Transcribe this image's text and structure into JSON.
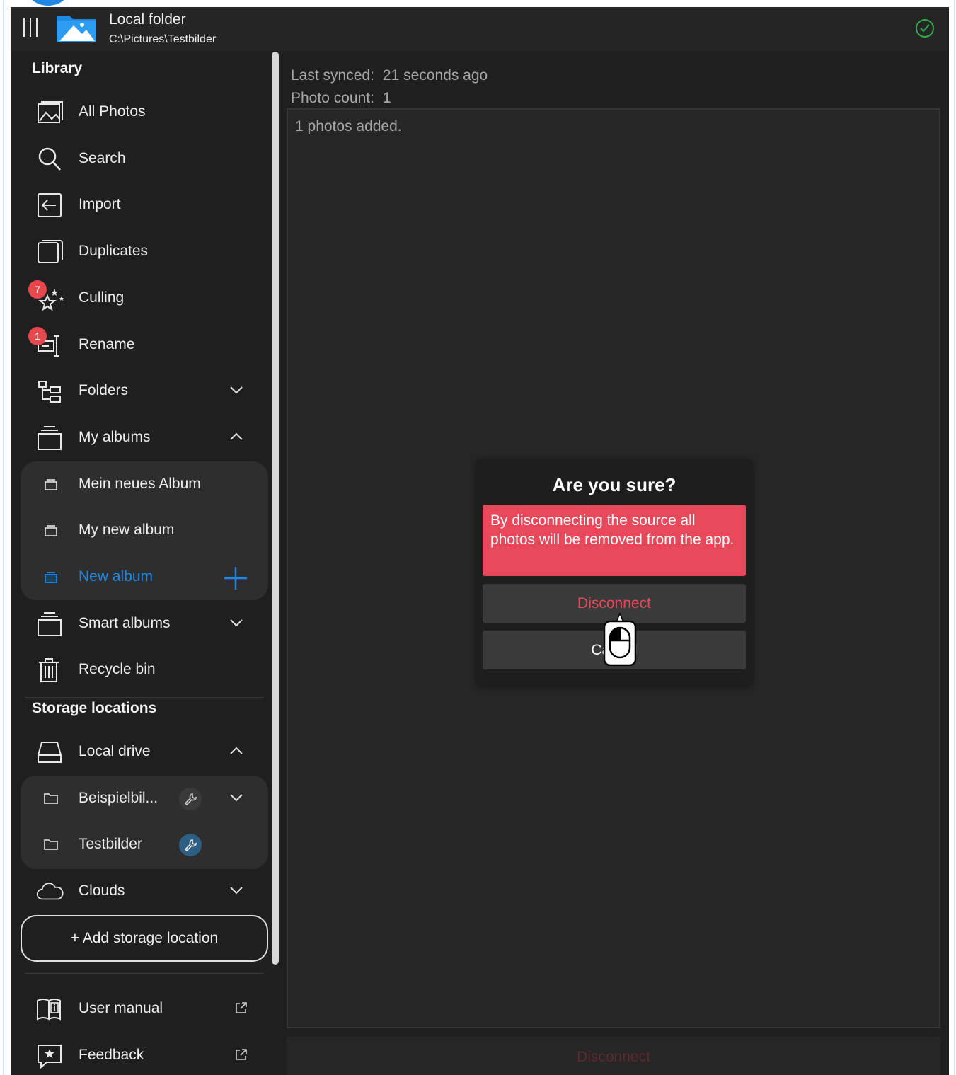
{
  "header": {
    "title": "Local folder",
    "path": "C:\\Pictures\\Testbilder"
  },
  "sidebar": {
    "library_title": "Library",
    "items": [
      {
        "label": "All Photos"
      },
      {
        "label": "Search"
      },
      {
        "label": "Import"
      },
      {
        "label": "Duplicates"
      },
      {
        "label": "Culling",
        "badge": "7"
      },
      {
        "label": "Rename",
        "badge": "1"
      },
      {
        "label": "Folders"
      },
      {
        "label": "My albums"
      }
    ],
    "albums": [
      {
        "label": "Mein neues Album"
      },
      {
        "label": "My new album"
      },
      {
        "label": "New album"
      }
    ],
    "smart_albums": "Smart albums",
    "recycle_bin": "Recycle bin",
    "storage_title": "Storage locations",
    "local_drive": "Local drive",
    "folders": [
      {
        "label": "Beispielbil..."
      },
      {
        "label": "Testbilder"
      }
    ],
    "clouds": "Clouds",
    "add_storage": "+ Add storage location",
    "user_manual": "User manual",
    "feedback": "Feedback"
  },
  "main": {
    "last_synced_label": "Last synced:",
    "last_synced_value": "21 seconds ago",
    "photo_count_label": "Photo count:",
    "photo_count_value": "1",
    "log": "1 photos added.",
    "bottom_button": "Disconnect"
  },
  "dialog": {
    "title": "Are you sure?",
    "warning": "By disconnecting the source all photos will be removed from the app.",
    "confirm": "Disconnect",
    "cancel": "Cancel"
  },
  "colors": {
    "accent": "#1d88e6",
    "danger": "#e8495a",
    "badge": "#e5484d",
    "success": "#2faa4f"
  }
}
